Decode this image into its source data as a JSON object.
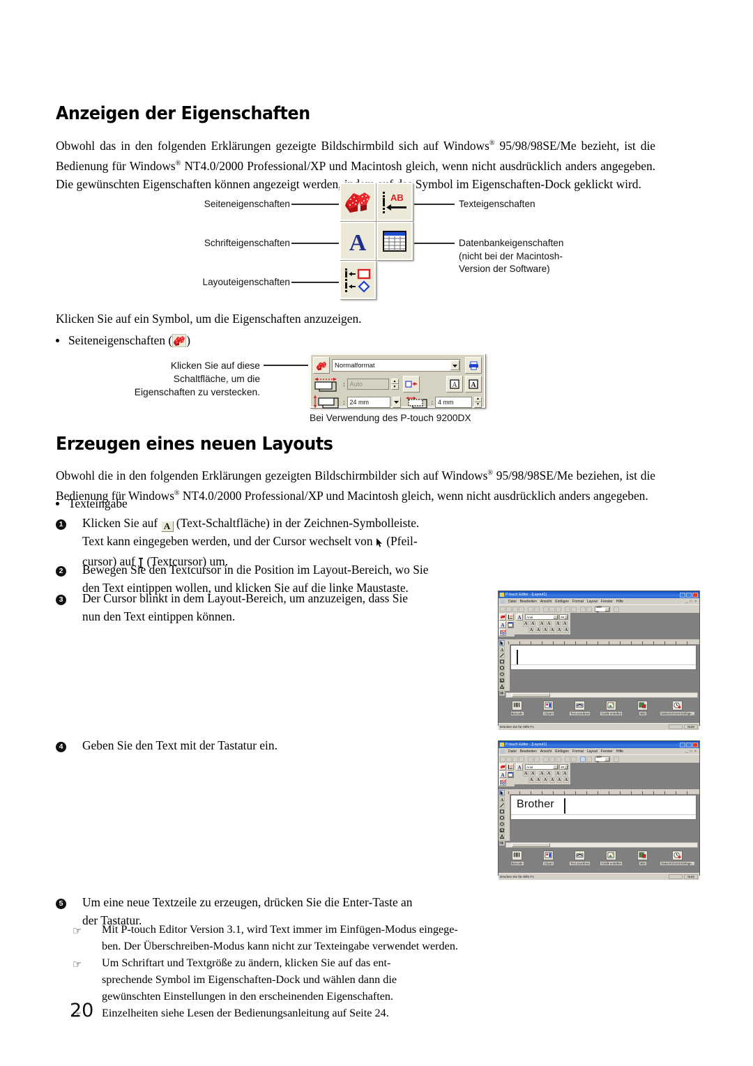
{
  "page": {
    "number": "20"
  },
  "section1": {
    "heading": "Anzeigen der Eigenschaften",
    "paragraph_line1": "Obwohl das in den folgenden Erklärungen gezeigte Bildschirmbild sich auf Windows",
    "paragraph_sup1": "®",
    "paragraph_line1b": " 95/98/98SE/Me bezieht, ist die",
    "paragraph_line2": "Bedienung für Windows",
    "paragraph_sup2": "®",
    "paragraph_line2b": " NT4.0/2000 Professional/XP und Macintosh gleich, wenn nicht ausdrücklich anders angegeben.",
    "paragraph_line3": "Die gewünschten Eigenschaften können angezeigt werden, indem auf das Symbol im Eigenschaften-Dock geklickt wird.",
    "diagram": {
      "labels_left": [
        "Seiteneigenschaften",
        "Schrifteigenschaften",
        "Layouteigenschaften"
      ],
      "labels_right": [
        "Texteigenschaften",
        "Datenbankeigenschaften"
      ],
      "label_right_note_line1": "(nicht bei der Macintosh-",
      "label_right_note_line2": "Version der Software)",
      "icons": [
        "page-properties-icon",
        "text-properties-icon",
        "font-properties-icon",
        "database-properties-icon",
        "layout-properties-icon"
      ]
    },
    "instruction": "Klicken Sie auf ein Symbol, um die Eigenschaften anzuzeigen.",
    "bullet1_pre": "Seiteneigenschaften (",
    "bullet1_post": ")",
    "callout_line1": "Klicken Sie auf diese",
    "callout_line2": "Schaltfläche, um die",
    "callout_line3": "Eigenschaften zu verstecken.",
    "propdock": {
      "format_value": "Normalformat",
      "length_value": "Auto",
      "width_value": "24 mm",
      "margin_value": "4 mm"
    },
    "propdock_caption": "Bei Verwendung des P-touch 9200DX"
  },
  "section2": {
    "heading": "Erzeugen eines neuen Layouts",
    "paragraph_line1": "Obwohl die in den folgenden Erklärungen gezeigten Bildschirmbilder sich auf Windows",
    "paragraph_sup1": "®",
    "paragraph_line1b": " 95/98/98SE/Me beziehen, ist die",
    "paragraph_line2": "Bedienung für Windows",
    "paragraph_sup2": "®",
    "paragraph_line2b": " NT4.0/2000 Professional/XP und Macintosh gleich, wenn nicht ausdrücklich anders angegeben.",
    "bullet_texteingabe": "Texteingabe",
    "steps": [
      {
        "num": "1",
        "line1_pre": "Klicken Sie auf ",
        "button_label": "A",
        "line1_post": " (Text-Schaltfläche) in der Zeichnen-Symbolleiste.",
        "line2_pre": "Text kann eingegeben werden, und der Cursor wechselt von ",
        "line2_post": " (Pfeil-",
        "line3_pre": "cursor) auf ",
        "line3_post": " (Textcursor) um."
      },
      {
        "num": "2",
        "line1": "Bewegen Sie den Textcursor in die Position im Layout-Bereich, wo Sie",
        "line2": "den Text eintippen wollen, und klicken Sie auf die linke Maustaste."
      },
      {
        "num": "3",
        "line1": "Der Cursor blinkt in dem Layout-Bereich, um anzuzeigen, dass Sie",
        "line2": "nun den Text eintippen können."
      },
      {
        "num": "4",
        "line1": "Geben Sie den Text mit der Tastatur ein."
      },
      {
        "num": "5",
        "line1": "Um eine neue Textzeile zu erzeugen, drücken Sie die Enter-Taste an",
        "line2": "der Tastatur."
      }
    ],
    "notes": [
      {
        "line1": "Mit P-touch Editor Version 3.1, wird Text immer im Einfügen-Modus eingege-",
        "line2": "ben. Der Überschreiben-Modus kann nicht zur Texteingabe verwendet werden."
      },
      {
        "line1": "Um Schriftart und Textgröße zu ändern, klicken Sie auf das ent-",
        "line2": "sprechende Symbol im Eigenschaften-Dock und wählen dann die",
        "line3": "gewünschten Einstellungen in den erscheinenden Eigenschaften."
      },
      {
        "line1": "Einzelheiten siehe Lesen der Bedienungsanleitung auf Seite 24."
      }
    ]
  },
  "screenshot1": {
    "title": "P-touch Editor - [Layout1]",
    "menu": [
      "Datei",
      "Bearbeiten",
      "Ansicht",
      "Einfügen",
      "Format",
      "Layout",
      "Fenster",
      "Hilfe"
    ],
    "zoom_value": "100 %",
    "font_name": "Arial",
    "font_size": "28",
    "canvas_text": "",
    "bottom_buttons": [
      "Barcode",
      "Clipart",
      "Text anordnen",
      "Grafik erstellen",
      "Bild",
      "Datum/Uhrzeit Einfüge..."
    ],
    "status_text": "Drücken Sie für Hilfe F1",
    "status_indicator": "NUM"
  },
  "screenshot2": {
    "title": "P-touch Editor - [Layout1]",
    "menu": [
      "Datei",
      "Bearbeiten",
      "Ansicht",
      "Einfügen",
      "Format",
      "Layout",
      "Fenster",
      "Hilfe"
    ],
    "zoom_value": "100 %",
    "font_name": "Arial",
    "font_size": "28",
    "canvas_text": "Brother",
    "bottom_buttons": [
      "Barcode",
      "Clipart",
      "Text anordnen",
      "Grafik erstellen",
      "Bild",
      "Datum/Uhrzeit Einfüge..."
    ],
    "status_text": "Drücken Sie für Hilfe F1",
    "status_indicator": "NUM"
  },
  "colors": {
    "accent_red": "#d8232a",
    "accent_blue": "#1f2f8f",
    "titlebar_blue": "#0a4ec4",
    "dock_beige": "#ece9d8"
  }
}
